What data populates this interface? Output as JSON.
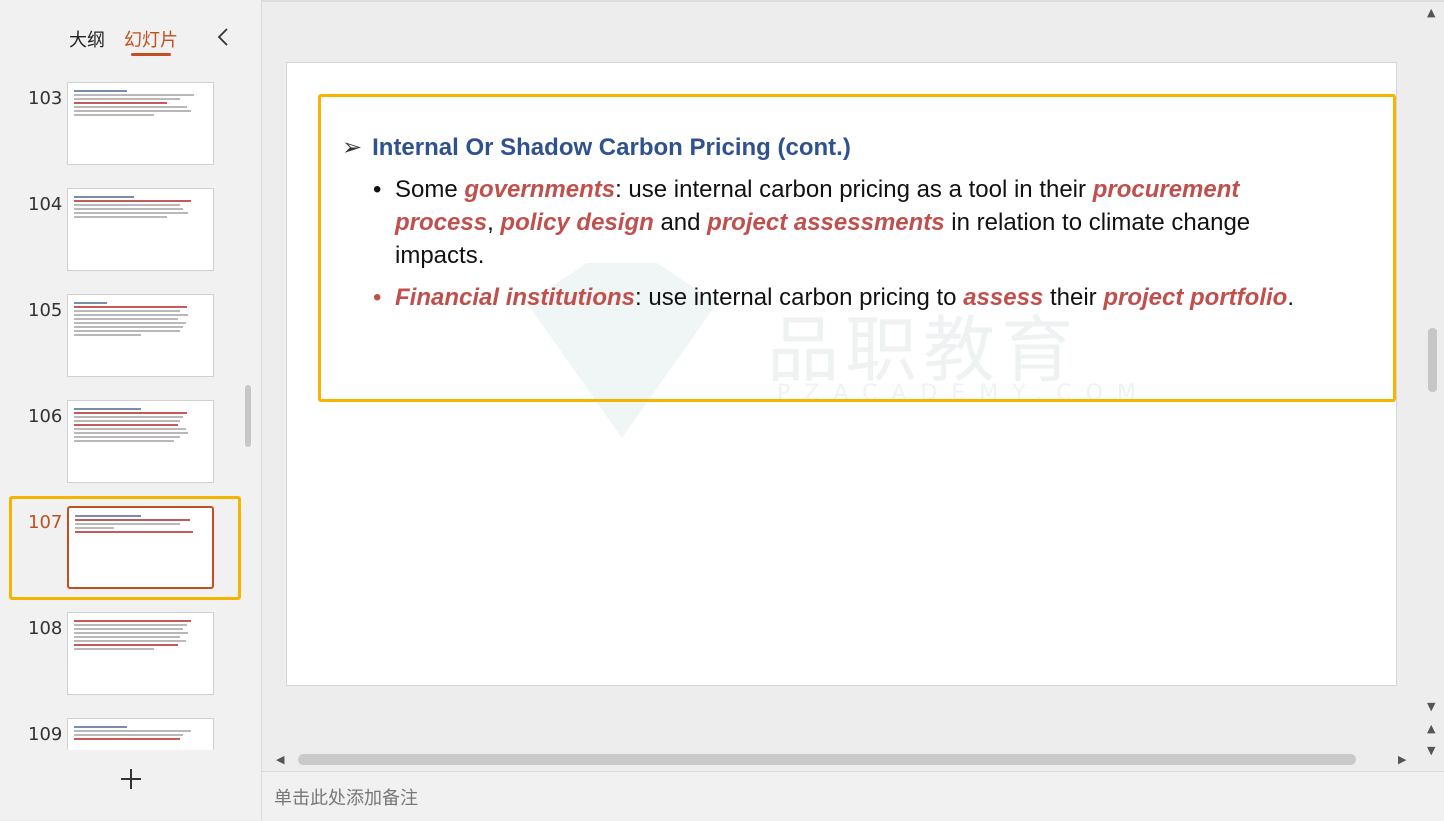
{
  "left_panel": {
    "tab_outline": "大纲",
    "tab_slides": "幻灯片",
    "add_slide_icon": "plus-icon",
    "collapse_icon": "chevron-left-icon"
  },
  "thumbnails": [
    {
      "number": "103",
      "active": false
    },
    {
      "number": "104",
      "active": false
    },
    {
      "number": "105",
      "active": false
    },
    {
      "number": "106",
      "active": false
    },
    {
      "number": "107",
      "active": true
    },
    {
      "number": "108",
      "active": false
    },
    {
      "number": "109",
      "active": false
    }
  ],
  "slide": {
    "heading": "Internal Or Shadow Carbon Pricing (cont.)",
    "bullet1": {
      "t1": "Some ",
      "e1": "governments",
      "t2": ": use internal carbon pricing  as a tool in their ",
      "e2": "procurement process",
      "t3": ", ",
      "e3": "policy design",
      "t4": " and ",
      "e4": "project assessments",
      "t5": " in relation to climate change impacts."
    },
    "bullet2": {
      "e1": "Financial institutions",
      "t1": ": use internal carbon pricing  to ",
      "e2": "assess",
      "t2": " their ",
      "e3": "project portfolio",
      "t3": "."
    },
    "watermark_text": "品职教育",
    "watermark_sub": "PZACADEMY.COM"
  },
  "notes": {
    "placeholder": "单击此处添加备注"
  },
  "colors": {
    "accent": "#c0501f",
    "highlight": "#f5b400",
    "heading": "#2f528f",
    "emphasis": "#c0504d"
  }
}
